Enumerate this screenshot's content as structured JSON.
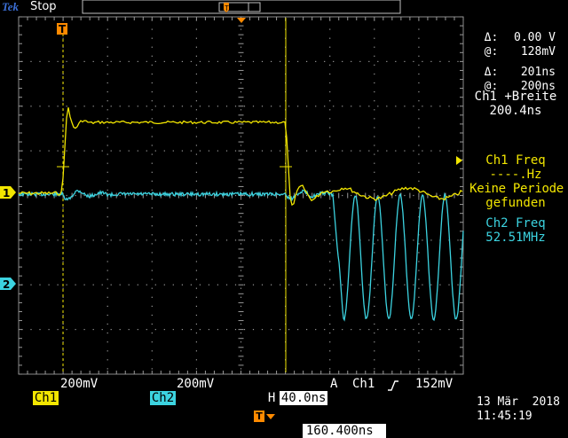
{
  "brand": "Tek",
  "run_state": "Stop",
  "cursor_readout": {
    "dv_label": "Δ:",
    "dv_value": "0.00 V",
    "v_label": "@:",
    "v_value": "128mV",
    "dt_label": "Δ:",
    "dt_value": "201ns",
    "t_label": "@:",
    "t_value": "200ns"
  },
  "measurements": [
    {
      "name": "Ch1 +Breite",
      "value": "200.4ns",
      "color": "#ffffff"
    },
    {
      "name": "Ch1 Freq",
      "value": "----.Hz",
      "extra1": "Keine Periode",
      "extra2": "gefunden",
      "color": "#f2e600"
    },
    {
      "name": "Ch2 Freq",
      "value": "52.51MHz",
      "color": "#3cd3e0"
    }
  ],
  "bottom": {
    "ch1_label": "Ch1",
    "ch1_scale": "200mV",
    "ch2_label": "Ch2",
    "ch2_scale": "200mV",
    "h_label": "H",
    "h_scale": "40.0ns",
    "trig_label": "A",
    "trig_source": "Ch1",
    "trig_level": "152mV",
    "trig_pos_value": "160.400ns",
    "date": "13 Mär  2018",
    "time": "11:45:19"
  },
  "markers": {
    "trigger": "T",
    "ch1": "1",
    "ch2": "2"
  },
  "colors": {
    "ch1": "#f2e600",
    "ch2": "#3cd3e0",
    "grid": "#9a9a9a",
    "trigger_marker": "#ff8a00",
    "brand": "#3b6fd6"
  }
}
